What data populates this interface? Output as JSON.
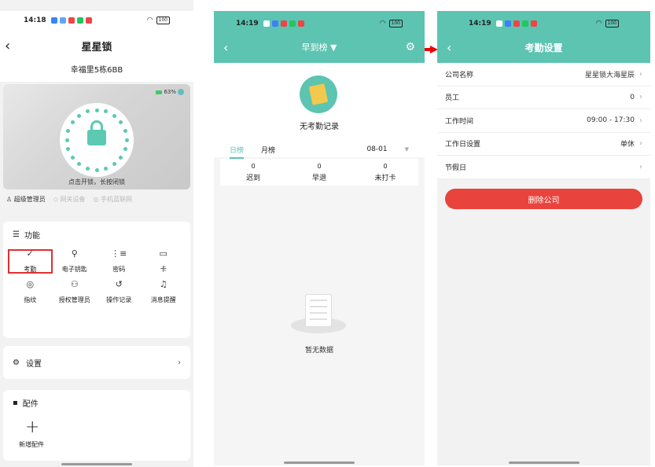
{
  "screen1": {
    "status_time": "14:18",
    "battery": "100",
    "title": "星星锁",
    "address": "幸福里5栋6BB",
    "lock_battery": "63%",
    "lock_hint": "点击开锁，长按闭锁",
    "roles": [
      "超级管理员",
      "网关设备",
      "手机蓝联网"
    ],
    "functions_title": "功能",
    "functions": [
      {
        "label": "考勤",
        "icon": "✓"
      },
      {
        "label": "电子钥匙",
        "icon": "⚲"
      },
      {
        "label": "密码",
        "icon": "⋮≡"
      },
      {
        "label": "卡",
        "icon": "▭"
      },
      {
        "label": "指纹",
        "icon": "◎"
      },
      {
        "label": "授权管理员",
        "icon": "⚇"
      },
      {
        "label": "操作记录",
        "icon": "↺"
      },
      {
        "label": "消息提醒",
        "icon": "♫"
      }
    ],
    "settings_label": "设置",
    "accessories_title": "配件",
    "add_accessory": "新增配件"
  },
  "screen2": {
    "status_time": "14:19",
    "battery": "100",
    "title": "早到榜 ▼",
    "no_record": "无考勤记录",
    "tab_day": "日榜",
    "tab_month": "月榜",
    "date": "08-01",
    "stats": [
      {
        "value": "0",
        "label": "迟到"
      },
      {
        "value": "0",
        "label": "早退"
      },
      {
        "value": "0",
        "label": "未打卡"
      }
    ],
    "empty_text": "暂无数据"
  },
  "screen3": {
    "status_time": "14:19",
    "battery": "100",
    "title": "考勤设置",
    "rows": [
      {
        "label": "公司名称",
        "value": "星星锁大海星辰"
      },
      {
        "label": "员工",
        "value": "0"
      },
      {
        "label": "工作时间",
        "value": "09:00 - 17:30"
      },
      {
        "label": "工作日设置",
        "value": "单休"
      },
      {
        "label": "节假日",
        "value": ""
      }
    ],
    "delete_label": "删除公司"
  },
  "colors": {
    "accent": "#5cc4b1",
    "danger": "#e8433d",
    "highlight": "#e03030"
  }
}
